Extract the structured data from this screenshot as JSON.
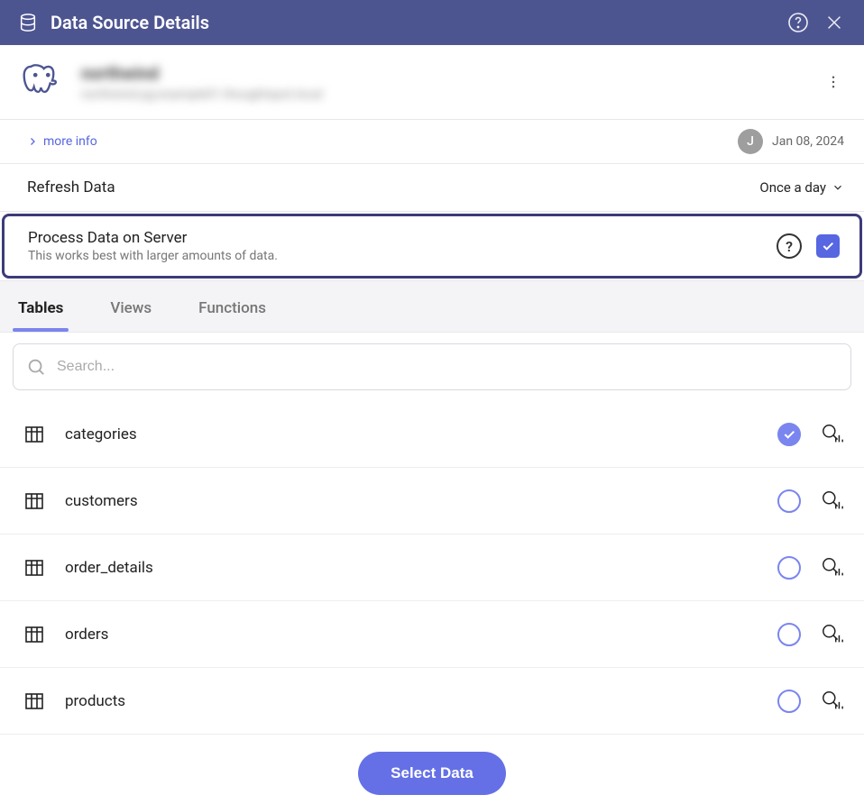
{
  "header": {
    "title": "Data Source Details"
  },
  "datasource": {
    "name": "northwind",
    "subtitle": "northwind.pg-example01.thoughtspot.local"
  },
  "meta": {
    "more_info": "more info",
    "avatar_initial": "J",
    "date": "Jan 08, 2024"
  },
  "refresh": {
    "label": "Refresh Data",
    "frequency": "Once a day"
  },
  "process": {
    "title": "Process Data on Server",
    "subtitle": "This works best with larger amounts of data.",
    "checked": true
  },
  "tabs": {
    "items": [
      {
        "label": "Tables",
        "active": true
      },
      {
        "label": "Views",
        "active": false
      },
      {
        "label": "Functions",
        "active": false
      }
    ]
  },
  "search": {
    "placeholder": "Search..."
  },
  "tables": [
    {
      "name": "categories",
      "selected": true
    },
    {
      "name": "customers",
      "selected": false
    },
    {
      "name": "order_details",
      "selected": false
    },
    {
      "name": "orders",
      "selected": false
    },
    {
      "name": "products",
      "selected": false
    }
  ],
  "footer": {
    "select_data": "Select Data"
  }
}
